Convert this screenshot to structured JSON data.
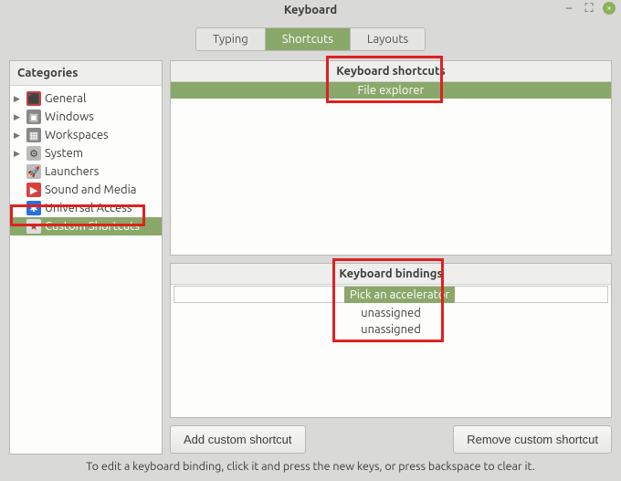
{
  "window": {
    "title": "Keyboard"
  },
  "tabs": {
    "typing": "Typing",
    "shortcuts": "Shortcuts",
    "layouts": "Layouts"
  },
  "categories": {
    "header": "Categories",
    "items": {
      "general": "General",
      "windows": "Windows",
      "workspaces": "Workspaces",
      "system": "System",
      "launchers": "Launchers",
      "sound": "Sound and Media",
      "universal": "Universal Access",
      "custom": "Custom Shortcuts"
    }
  },
  "shortcuts_panel": {
    "header": "Keyboard shortcuts",
    "selected": "File explorer"
  },
  "bindings_panel": {
    "header": "Keyboard bindings",
    "rows": {
      "r0": "Pick an accelerator",
      "r1": "unassigned",
      "r2": "unassigned"
    }
  },
  "buttons": {
    "add": "Add custom shortcut",
    "remove": "Remove custom shortcut"
  },
  "footer": "To edit a keyboard binding, click it and press the new keys, or press backspace to clear it."
}
